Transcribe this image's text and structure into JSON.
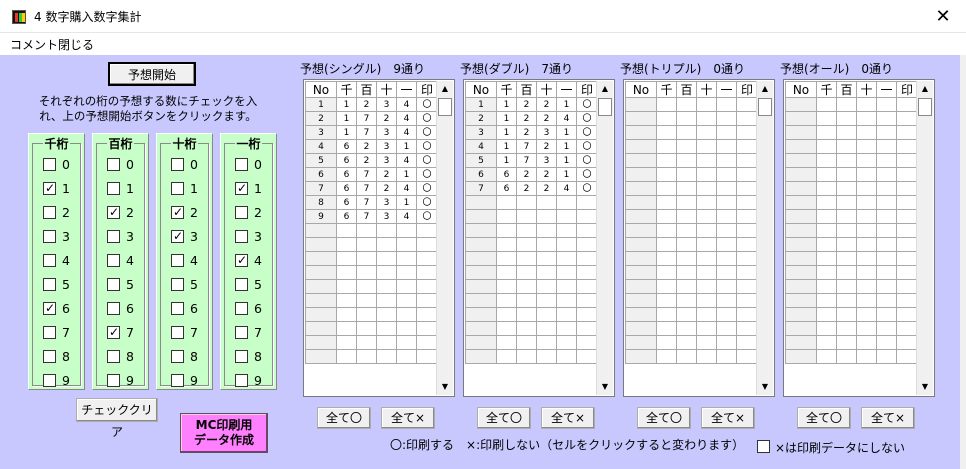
{
  "window": {
    "title": "4 数字購入数字集計",
    "close_glyph": "✕"
  },
  "menu": [
    "コメント",
    "閉じる"
  ],
  "buttons": {
    "yoso_start": "予想開始",
    "check_clear": "チェッククリア",
    "mc_print": "MC印刷用データ作成",
    "all_o": "全て〇",
    "all_x": "全て×"
  },
  "instruction": "それぞれの桁の予想する数にチェックを入れ、上の予想開始ボタンをクリックます。",
  "digit_groups": [
    {
      "title": "千桁",
      "checked": [
        1,
        6
      ]
    },
    {
      "title": "百桁",
      "checked": [
        2,
        7
      ]
    },
    {
      "title": "十桁",
      "checked": [
        2,
        3
      ]
    },
    {
      "title": "一桁",
      "checked": [
        1,
        4
      ]
    }
  ],
  "digits": [
    "0",
    "1",
    "2",
    "3",
    "4",
    "5",
    "6",
    "7",
    "8",
    "9"
  ],
  "grid_headers": [
    "No",
    "千",
    "百",
    "十",
    "一",
    "印"
  ],
  "panels": [
    {
      "title": "予想(シングル)　9通り",
      "rows": [
        [
          "1",
          "1",
          "2",
          "3",
          "4",
          "〇"
        ],
        [
          "2",
          "1",
          "7",
          "2",
          "4",
          "〇"
        ],
        [
          "3",
          "1",
          "7",
          "3",
          "4",
          "〇"
        ],
        [
          "4",
          "6",
          "2",
          "3",
          "1",
          "〇"
        ],
        [
          "5",
          "6",
          "2",
          "3",
          "4",
          "〇"
        ],
        [
          "6",
          "6",
          "7",
          "2",
          "1",
          "〇"
        ],
        [
          "7",
          "6",
          "7",
          "2",
          "4",
          "〇"
        ],
        [
          "8",
          "6",
          "7",
          "3",
          "1",
          "〇"
        ],
        [
          "9",
          "6",
          "7",
          "3",
          "4",
          "〇"
        ]
      ]
    },
    {
      "title": "予想(ダブル)　7通り",
      "rows": [
        [
          "1",
          "1",
          "2",
          "2",
          "1",
          "〇"
        ],
        [
          "2",
          "1",
          "2",
          "2",
          "4",
          "〇"
        ],
        [
          "3",
          "1",
          "2",
          "3",
          "1",
          "〇"
        ],
        [
          "4",
          "1",
          "7",
          "2",
          "1",
          "〇"
        ],
        [
          "5",
          "1",
          "7",
          "3",
          "1",
          "〇"
        ],
        [
          "6",
          "6",
          "2",
          "2",
          "1",
          "〇"
        ],
        [
          "7",
          "6",
          "2",
          "2",
          "4",
          "〇"
        ]
      ]
    },
    {
      "title": "予想(トリプル)　0通り",
      "rows": []
    },
    {
      "title": "予想(オール)　0通り",
      "rows": []
    }
  ],
  "legend": "〇:印刷する　×:印刷しない（セルをクリックすると変わります）",
  "noprint_label": "×は印刷データにしない",
  "colors": {
    "client_bg": "#c8c8ff",
    "digit_bg": "#c8ffc8",
    "mc_button": "#ff80ff"
  }
}
